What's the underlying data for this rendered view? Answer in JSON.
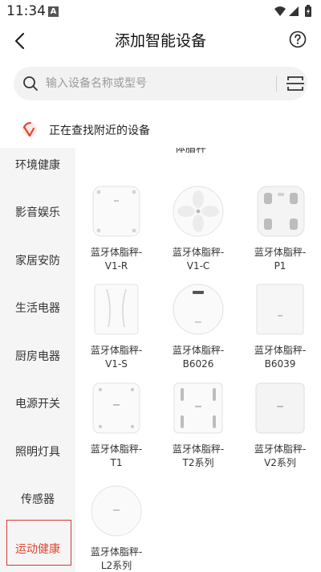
{
  "status_bar": {
    "time": "11:34",
    "notif_letter": "A"
  },
  "header": {
    "title": "添加智能设备"
  },
  "search": {
    "placeholder": "输入设备名称或型号"
  },
  "nearby": {
    "text": "正在查找附近的设备"
  },
  "sidebar": {
    "items": [
      {
        "label": "环境健康"
      },
      {
        "label": "影音娱乐"
      },
      {
        "label": "家居安防"
      },
      {
        "label": "生活电器"
      },
      {
        "label": "厨房电器"
      },
      {
        "label": "电源开关"
      },
      {
        "label": "照明灯具"
      },
      {
        "label": "传感器"
      },
      {
        "label": "运动健康"
      }
    ],
    "active_index": 8
  },
  "content": {
    "section_title": "体脂秤",
    "devices": [
      {
        "line1": "蓝牙体脂秤-",
        "line2": "V1-R",
        "icon": "square-scale-icon"
      },
      {
        "line1": "蓝牙体脂秤-",
        "line2": "V1-C",
        "icon": "round-petal-scale-icon"
      },
      {
        "line1": "蓝牙体脂秤-",
        "line2": "P1",
        "icon": "electrode-scale-icon"
      },
      {
        "line1": "蓝牙体脂秤-",
        "line2": "V1-S",
        "icon": "body-outline-scale-icon"
      },
      {
        "line1": "蓝牙体脂秤-",
        "line2": "B6026",
        "icon": "round-display-scale-icon"
      },
      {
        "line1": "蓝牙体脂秤-",
        "line2": "B6039",
        "icon": "plain-square-scale-icon"
      },
      {
        "line1": "蓝牙体脂秤-",
        "line2": "T1",
        "icon": "dotted-scale-icon"
      },
      {
        "line1": "蓝牙体脂秤-",
        "line2": "T2系列",
        "icon": "bar-electrode-scale-icon"
      },
      {
        "line1": "蓝牙体脂秤-",
        "line2": "V2系列",
        "icon": "rounded-square-scale-icon"
      },
      {
        "line1": "蓝牙体脂秤-",
        "line2": "L2系列",
        "icon": "round-scale-icon"
      }
    ]
  },
  "colors": {
    "accent_red": "#e0452f",
    "active_border": "#d23a36",
    "sidebar_bg": "#f5f5f6",
    "search_bg": "#f2f2f2"
  }
}
